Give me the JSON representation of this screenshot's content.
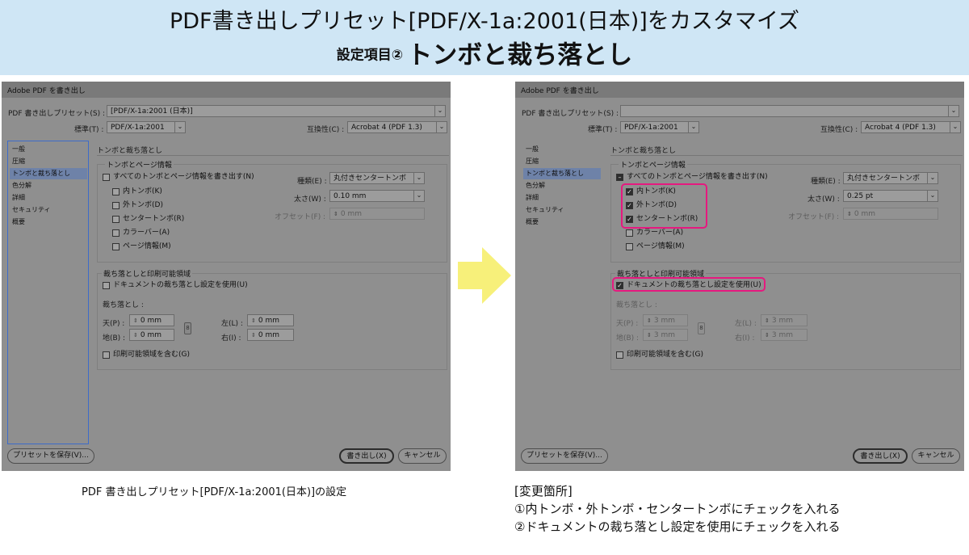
{
  "banner": {
    "title": "PDF書き出しプリセット[PDF/X-1a:2001(日本)]をカスタマイズ",
    "subtitle_small": "設定項目②",
    "subtitle_big": "トンボと裁ち落とし"
  },
  "left": {
    "window_title": "Adobe PDF を書き出し",
    "preset_label": "PDF 書き出しプリセット(S) :",
    "preset_value": "[PDF/X-1a:2001 (日本)]",
    "standard_label": "標準(T) :",
    "standard_value": "PDF/X-1a:2001",
    "compat_label": "互換性(C) :",
    "compat_value": "Acrobat 4 (PDF 1.3)",
    "sidebar": [
      "一般",
      "圧縮",
      "トンボと裁ち落とし",
      "色分解",
      "詳細",
      "セキュリティ",
      "概要"
    ],
    "section_title": "トンボと裁ち落とし",
    "marks_group": "トンボとページ情報",
    "all_marks": "すべてのトンボとページ情報を書き出す(N)",
    "marks": [
      "内トンボ(K)",
      "外トンボ(D)",
      "センタートンボ(R)",
      "カラーバー(A)",
      "ページ情報(M)"
    ],
    "type_label": "種類(E) :",
    "type_value": "丸付きセンタートンボ",
    "weight_label": "太さ(W) :",
    "weight_value": "0.10 mm",
    "offset_label": "オフセット(F) :",
    "offset_value": "0 mm",
    "bleed_group": "裁ち落としと印刷可能領域",
    "use_doc_bleed": "ドキュメントの裁ち落とし設定を使用(U)",
    "bleed_label": "裁ち落とし :",
    "top_label": "天(P) :",
    "top_value": "0 mm",
    "bottom_label": "地(B) :",
    "bottom_value": "0 mm",
    "left_label": "左(L) :",
    "left_value": "0 mm",
    "right_label": "右(I) :",
    "right_value": "0 mm",
    "include_slug": "印刷可能領域を含む(G)",
    "save_preset": "プリセットを保存(V)...",
    "export": "書き出し(X)",
    "cancel": "キャンセル"
  },
  "right": {
    "window_title": "Adobe PDF を書き出し",
    "preset_label": "PDF 書き出しプリセット(S) :",
    "preset_value": "",
    "standard_label": "標準(T) :",
    "standard_value": "PDF/X-1a:2001",
    "compat_label": "互換性(C) :",
    "compat_value": "Acrobat 4 (PDF 1.3)",
    "sidebar": [
      "一般",
      "圧縮",
      "トンボと裁ち落とし",
      "色分解",
      "詳細",
      "セキュリティ",
      "概要"
    ],
    "section_title": "トンボと裁ち落とし",
    "marks_group": "トンボとページ情報",
    "all_marks": "すべてのトンボとページ情報を書き出す(N)",
    "marks": [
      "内トンボ(K)",
      "外トンボ(D)",
      "センタートンボ(R)",
      "カラーバー(A)",
      "ページ情報(M)"
    ],
    "marks_checked": [
      true,
      true,
      true,
      false,
      false
    ],
    "type_label": "種類(E) :",
    "type_value": "丸付きセンタートンボ",
    "weight_label": "太さ(W) :",
    "weight_value": "0.25 pt",
    "offset_label": "オフセット(F) :",
    "offset_value": "0 mm",
    "bleed_group": "裁ち落としと印刷可能領域",
    "use_doc_bleed": "ドキュメントの裁ち落とし設定を使用(U)",
    "bleed_label": "裁ち落とし :",
    "top_label": "天(P) :",
    "top_value": "3 mm",
    "bottom_label": "地(B) :",
    "bottom_value": "3 mm",
    "left_label": "左(L) :",
    "left_value": "3 mm",
    "right_label": "右(I) :",
    "right_value": "3 mm",
    "include_slug": "印刷可能領域を含む(G)",
    "save_preset": "プリセットを保存(V)...",
    "export": "書き出し(X)",
    "cancel": "キャンセル"
  },
  "caption_left": "PDF 書き出しプリセット[PDF/X-1a:2001(日本)]の設定",
  "notes": [
    "[変更箇所]",
    "①内トンボ・外トンボ・センタートンボにチェックを入れる",
    "②ドキュメントの裁ち落とし設定を使用にチェックを入れる"
  ],
  "colors": {
    "banner": "#cfe6f5",
    "highlight": "#e6197f",
    "arrow": "#f7f07a",
    "dialog": "#8f8f8f"
  }
}
